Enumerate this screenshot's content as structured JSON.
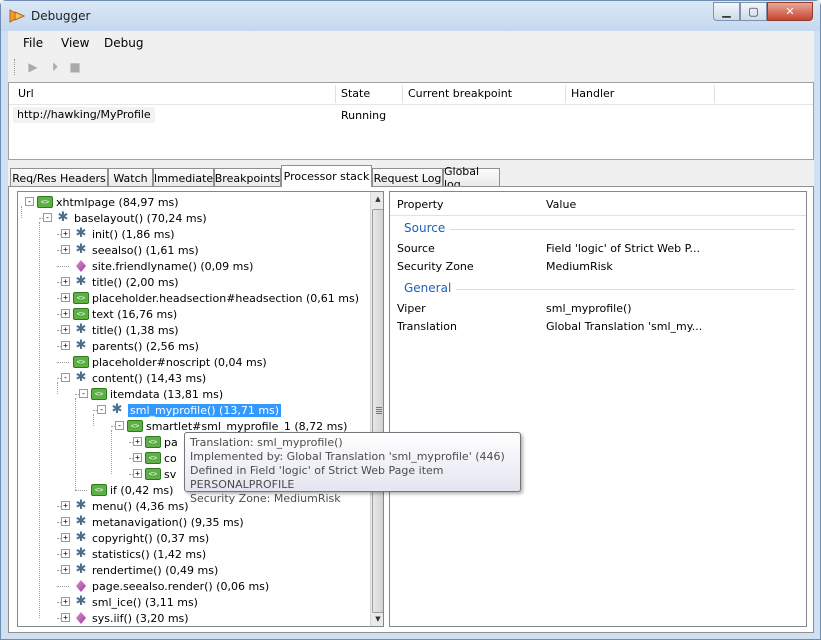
{
  "window": {
    "title": "Debugger"
  },
  "menu": [
    "File",
    "View",
    "Debug"
  ],
  "requests": {
    "columns": [
      "Url",
      "State",
      "Current breakpoint",
      "Handler"
    ],
    "rows": [
      {
        "url": "http://hawking/MyProfile",
        "state": "Running",
        "breakpoint": "",
        "handler": ""
      }
    ]
  },
  "tabs": [
    "Req/Res Headers",
    "Watch",
    "Immediate",
    "Breakpoints",
    "Processor stack",
    "Request Log",
    "Global log"
  ],
  "active_tab": "Processor stack",
  "tree": [
    {
      "label": "xhtmlpage (84,97 ms)",
      "icon": "xml-icon"
    },
    {
      "label": "baselayout() (70,24 ms)",
      "icon": "gear-icon"
    },
    {
      "label": "init() (1,86 ms)",
      "icon": "gear-icon"
    },
    {
      "label": "seealso() (1,61 ms)",
      "icon": "gear-icon"
    },
    {
      "label": "site.friendlyname() (0,09 ms)",
      "icon": "diamond-icon"
    },
    {
      "label": "title() (2,00 ms)",
      "icon": "gear-icon"
    },
    {
      "label": "placeholder.headsection#headsection (0,61 ms)",
      "icon": "xml-icon"
    },
    {
      "label": "text (16,76 ms)",
      "icon": "xml-icon"
    },
    {
      "label": "title() (1,38 ms)",
      "icon": "gear-icon"
    },
    {
      "label": "parents() (2,56 ms)",
      "icon": "gear-icon"
    },
    {
      "label": "placeholder#noscript (0,04 ms)",
      "icon": "xml-icon"
    },
    {
      "label": "content() (14,43 ms)",
      "icon": "gear-icon"
    },
    {
      "label": "itemdata (13,81 ms)",
      "icon": "xml-icon"
    },
    {
      "label": "sml_myprofile() (13,71 ms)",
      "icon": "gear-icon"
    },
    {
      "label": "smartlet#sml_myprofile_1 (8,72 ms)",
      "icon": "xml-icon"
    },
    {
      "label": "pa",
      "icon": "xml-icon"
    },
    {
      "label": "co",
      "icon": "xml-icon"
    },
    {
      "label": "sv",
      "icon": "xml-icon"
    },
    {
      "label": "if (0,42 ms)",
      "icon": "xml-icon"
    },
    {
      "label": "menu() (4,36 ms)",
      "icon": "gear-icon"
    },
    {
      "label": "metanavigation() (9,35 ms)",
      "icon": "gear-icon"
    },
    {
      "label": "copyright() (0,37 ms)",
      "icon": "gear-icon"
    },
    {
      "label": "statistics() (1,42 ms)",
      "icon": "gear-icon"
    },
    {
      "label": "rendertime() (0,49 ms)",
      "icon": "gear-icon"
    },
    {
      "label": "page.seealso.render() (0,06 ms)",
      "icon": "diamond-icon"
    },
    {
      "label": "sml_ice() (3,11 ms)",
      "icon": "gear-icon"
    },
    {
      "label": "sys.iif() (3,20 ms)",
      "icon": "diamond-icon"
    }
  ],
  "properties": {
    "columns": [
      "Property",
      "Value"
    ],
    "sections": [
      {
        "name": "Source",
        "rows": [
          {
            "key": "Source",
            "value": "Field 'logic' of Strict Web P..."
          },
          {
            "key": "Security Zone",
            "value": "MediumRisk"
          }
        ]
      },
      {
        "name": "General",
        "rows": [
          {
            "key": "Viper",
            "value": "sml_myprofile()"
          },
          {
            "key": "Translation",
            "value": "Global Translation 'sml_my..."
          }
        ]
      }
    ]
  },
  "tooltip": [
    "Translation: sml_myprofile()",
    "Implemented by: Global Translation 'sml_myprofile' (446)",
    "Defined in Field 'logic' of Strict Web Page item PERSONALPROFILE",
    "Security Zone: MediumRisk"
  ],
  "colors": {
    "selection": "#3399ff",
    "section_header": "#1f5fb8",
    "xml_icon": "#5cb046",
    "gear_icon": "#4d6f8f",
    "diamond_icon": "#c15fb5"
  }
}
